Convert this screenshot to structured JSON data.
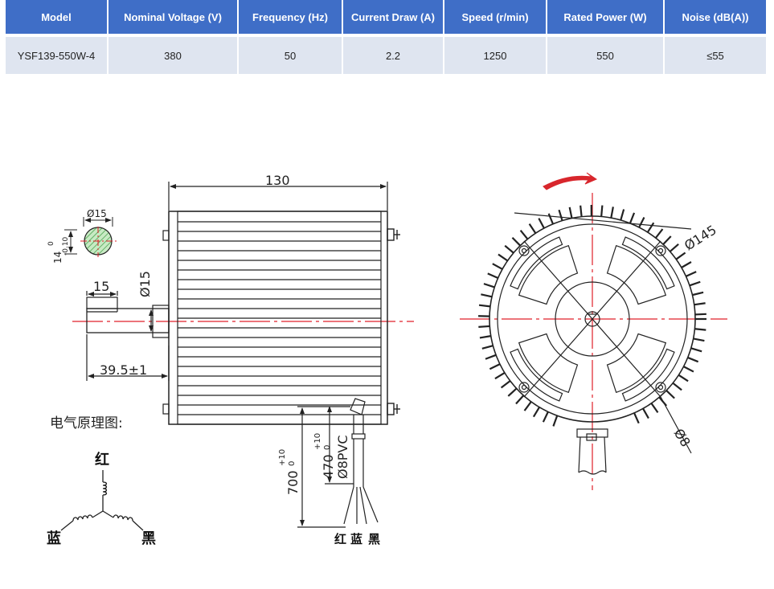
{
  "table": {
    "headers": [
      "Model",
      "Nominal Voltage (V)",
      "Frequency (Hz)",
      "Current Draw (A)",
      "Speed (r/min)",
      "Rated Power (W)",
      "Noise (dB(A))"
    ],
    "rows": [
      [
        "YSF139-550W-4",
        "380",
        "50",
        "2.2",
        "1250",
        "550",
        "≤55"
      ]
    ]
  },
  "drawing": {
    "dims": {
      "length": "130",
      "shaft_flat": "Ø15",
      "flat_height": "14",
      "flat_tol_upper": "0",
      "flat_tol_lower": "-0.10",
      "shaft_key": "15",
      "shaft_dia": "Ø15",
      "shaft_len": "39.5±1",
      "lead_total": "700",
      "lead_total_tol_upper": "+10",
      "lead_total_tol_lower": "0",
      "lead_pvc": "470",
      "lead_pvc_tol_upper": "+10",
      "lead_pvc_tol_lower": "0",
      "pvc_spec": "Ø8PVC",
      "outer_dia": "Ø145",
      "mount_dia": "Ø8"
    },
    "schematic": {
      "title": "电气原理图:",
      "red": "红",
      "blue": "蓝",
      "black": "黑"
    },
    "wire_labels": {
      "red": "红",
      "blue": "蓝",
      "black": "黑"
    },
    "colors": {
      "header_bg": "#3f6ec7",
      "cell_bg": "#dfe5f0",
      "centerline": "#e0202a",
      "hatch": "#3a9a40",
      "arrow": "#d8262c"
    }
  }
}
